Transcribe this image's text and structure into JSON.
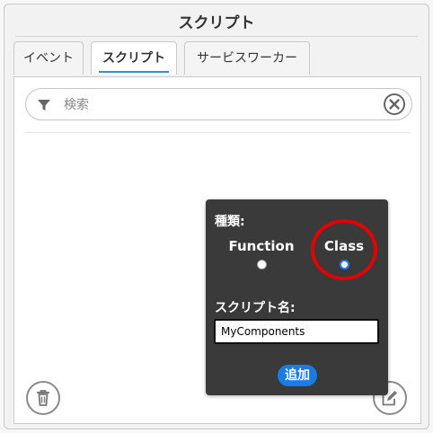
{
  "window": {
    "title": "スクリプト"
  },
  "tabs": [
    {
      "label": "イベント",
      "active": false
    },
    {
      "label": "スクリプト",
      "active": true
    },
    {
      "label": "サービスワーカー",
      "active": false
    }
  ],
  "search": {
    "placeholder": "検索",
    "value": ""
  },
  "icons": {
    "filter": "filter-icon",
    "clear": "close-circle-icon",
    "trash": "trash-icon",
    "edit": "edit-icon"
  },
  "popup": {
    "kind_label": "種類:",
    "options": [
      {
        "label": "Function",
        "selected": false
      },
      {
        "label": "Class",
        "selected": true
      }
    ],
    "name_label": "スクリプト名:",
    "name_value": "MyComponents",
    "add_label": "追加"
  },
  "colors": {
    "accent": "#1a7be6",
    "popup_bg": "#3a3a3a",
    "highlight": "#e30000",
    "tab_underline": "#3c8ad8"
  }
}
